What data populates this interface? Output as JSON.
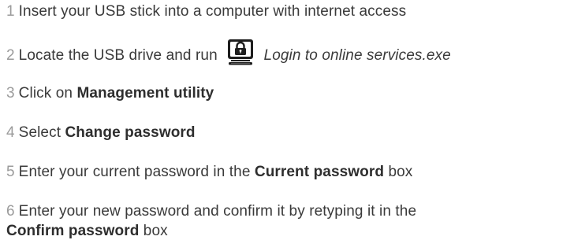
{
  "steps": [
    {
      "num": "1",
      "text": "Insert your USB stick into a computer with internet access"
    },
    {
      "num": "2",
      "text": "Locate the USB drive and run",
      "icon": "login-app-lock-icon",
      "italic": "Login to online services.exe"
    },
    {
      "num": "3",
      "text": "Click on ",
      "bold": "Management utility"
    },
    {
      "num": "4",
      "text": "Select ",
      "bold": "Change password"
    },
    {
      "num": "5",
      "text": "Enter your current password in the ",
      "bold": "Current password",
      "after": " box"
    },
    {
      "num": "6",
      "text": "Enter your new password and confirm it by retyping it in the",
      "bold2": "Confirm password",
      "after2": " box"
    }
  ],
  "colors": {
    "text": "#3a3a3a",
    "number": "#9b9b9b"
  }
}
